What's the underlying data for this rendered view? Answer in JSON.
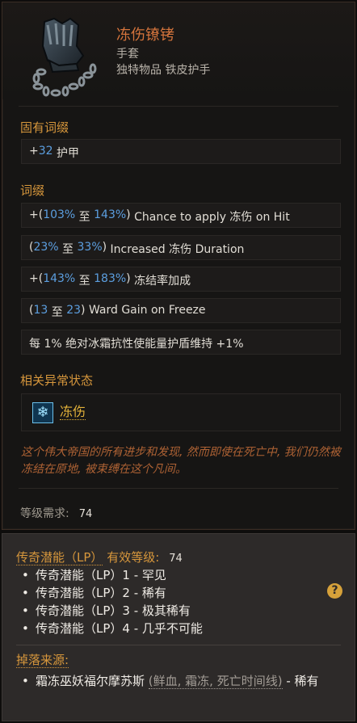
{
  "item": {
    "name": "冻伤镣铐",
    "type": "手套",
    "subtype": "独特物品 铁皮护手",
    "icon": "gauntlet-with-chains-icon"
  },
  "sections": {
    "implicit_title": "固有词缀",
    "affix_title": "词缀",
    "status_title": "相关异常状态"
  },
  "implicit": {
    "prefix": "+",
    "value": "32",
    "text": " 护甲"
  },
  "affixes": [
    {
      "p1": "+(",
      "v1": "103%",
      "mid": " 至 ",
      "v2": "143%",
      "p2": ")",
      "text": " Chance to apply 冻伤 on Hit"
    },
    {
      "p1": "(",
      "v1": "23%",
      "mid": " 至 ",
      "v2": "33%",
      "p2": ")",
      "text": " Increased 冻伤 Duration"
    },
    {
      "p1": "+(",
      "v1": "143%",
      "mid": " 至 ",
      "v2": "183%",
      "p2": ")",
      "text": " 冻结率加成"
    },
    {
      "p1": "(",
      "v1": "13",
      "mid": " 至 ",
      "v2": "23",
      "p2": ")",
      "text": " Ward Gain on Freeze"
    }
  ],
  "special_affix": "每 1% 绝对冰霜抗性使能量护盾维持 +1%",
  "status": {
    "label": "冻伤",
    "icon": "snowflake-icon"
  },
  "flavor": "这个伟大帝国的所有进步和发现, 然而即使在死亡中, 我们仍然被冻结在原地, 被束缚在这个凡间。",
  "requirement": {
    "label": "等级需求:",
    "value": "74"
  },
  "lp": {
    "title": "传奇潜能（LP）",
    "title_suffix": "有效等级:",
    "level": "74",
    "tiers": [
      "传奇潜能（LP）1 - 罕见",
      "传奇潜能（LP）2 - 稀有",
      "传奇潜能（LP）3 - 极其稀有",
      "传奇潜能（LP）4 - 几乎不可能"
    ],
    "help_icon": "question-mark-icon",
    "help_glyph": "?"
  },
  "drop": {
    "title": "掉落来源:",
    "source_name": "霜冻巫妖福尔摩苏斯",
    "source_tags": "(鲜血, 霜冻, 死亡时间线)",
    "source_rarity": " - 稀有"
  },
  "colors": {
    "item_name": "#d4743c",
    "section_title": "#d7973c",
    "value_blue": "#5c9fe0",
    "flavor": "#ae6234",
    "status_gold": "#e3b23a"
  }
}
